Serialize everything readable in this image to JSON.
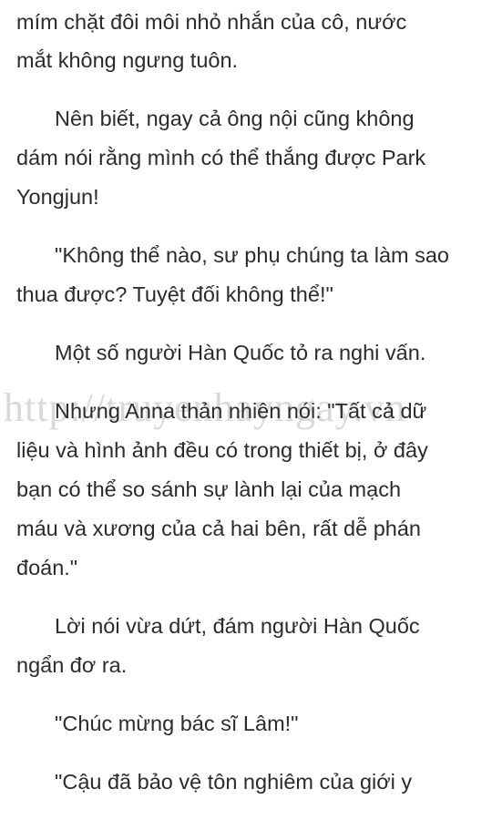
{
  "lines": [
    "mím chặt đôi môi nhỏ nhắn của cô, nước",
    "mắt không ngưng tuôn.",
    "Nên biết, ngay cả ông nội cũng không",
    "dám nói rằng mình có thể thắng được Park",
    "Yongjun!",
    "\"Không thể nào, sư phụ chúng ta làm sao",
    "thua được? Tuyệt đối không thể!\"",
    "Một số người Hàn Quốc tỏ ra nghi vấn.",
    "Nhưng Anna thản nhiên nói: \"Tất cả dữ",
    "liệu và hình ảnh đều có trong thiết bị, ở đây",
    "bạn có thể so sánh sự lành lại của mạch",
    "máu và xương của cả hai bên, rất dễ phán",
    "đoán.\"",
    "Lời nói vừa dứt, đám người Hàn Quốc",
    "ngẩn đơ ra.",
    "\"Chúc mừng bác sĩ Lâm!\"",
    "\"Cậu đã bảo vệ tôn nghiêm của giới y"
  ],
  "watermark": "http://truyenhayngay.vn"
}
